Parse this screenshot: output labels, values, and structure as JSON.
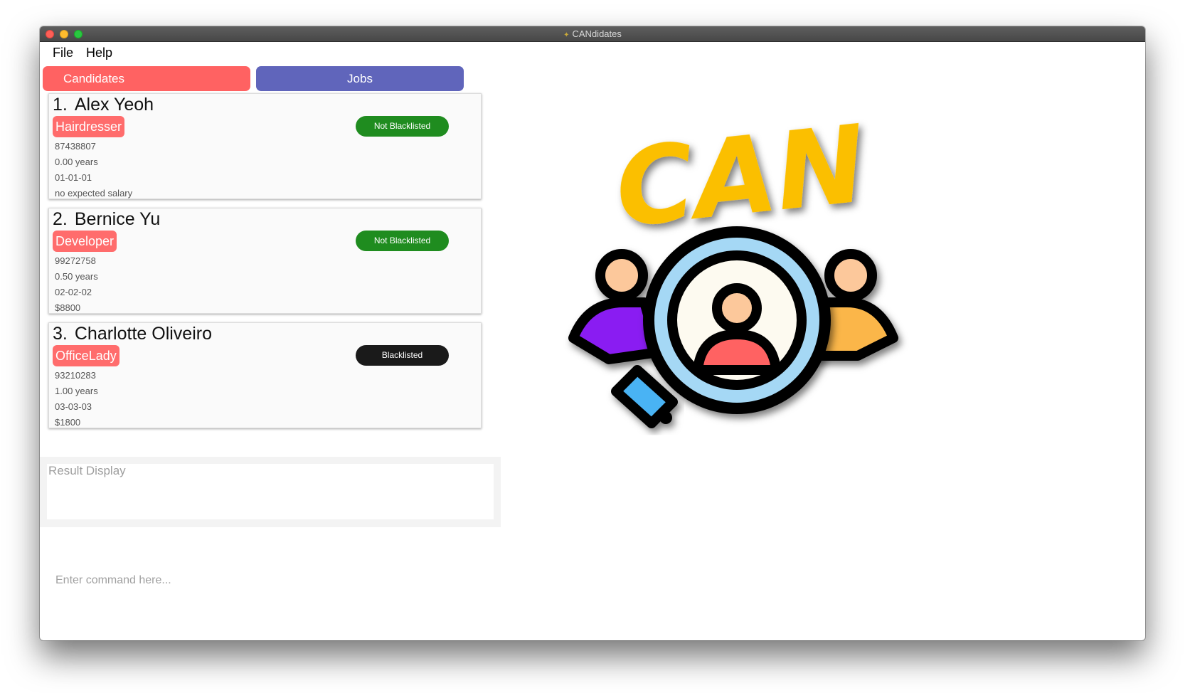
{
  "window": {
    "title": "CANdidates",
    "title_icon": "app-logo-icon"
  },
  "menu": {
    "file": "File",
    "help": "Help"
  },
  "tabs": {
    "candidates": "Candidates",
    "jobs": "Jobs"
  },
  "candidates": [
    {
      "index": "1.",
      "name": "Alex Yeoh",
      "job": "Hairdresser",
      "phone": "87438807",
      "experience": "0.00 years",
      "date": "01-01-01",
      "salary": "no expected salary",
      "status": "Not Blacklisted"
    },
    {
      "index": "2.",
      "name": "Bernice Yu",
      "job": "Developer",
      "phone": "99272758",
      "experience": "0.50 years",
      "date": "02-02-02",
      "salary": "$8800",
      "status": "Not Blacklisted"
    },
    {
      "index": "3.",
      "name": "Charlotte Oliveiro",
      "job": "OfficeLady",
      "phone": "93210283",
      "experience": "1.00 years",
      "date": "03-03-03",
      "salary": "$1800",
      "status": "Blacklisted"
    }
  ],
  "result": {
    "placeholder": "Result Display"
  },
  "command": {
    "placeholder": "Enter command here..."
  },
  "logo": {
    "text": "CAN"
  },
  "colors": {
    "candidates_tab": "#ff6262",
    "jobs_tab": "#6065bb",
    "job_tag": "#ff6c6c",
    "not_blacklisted": "#1f8c1f",
    "blacklisted": "#1a1a1a",
    "logo_letters": "#fbbf00"
  }
}
